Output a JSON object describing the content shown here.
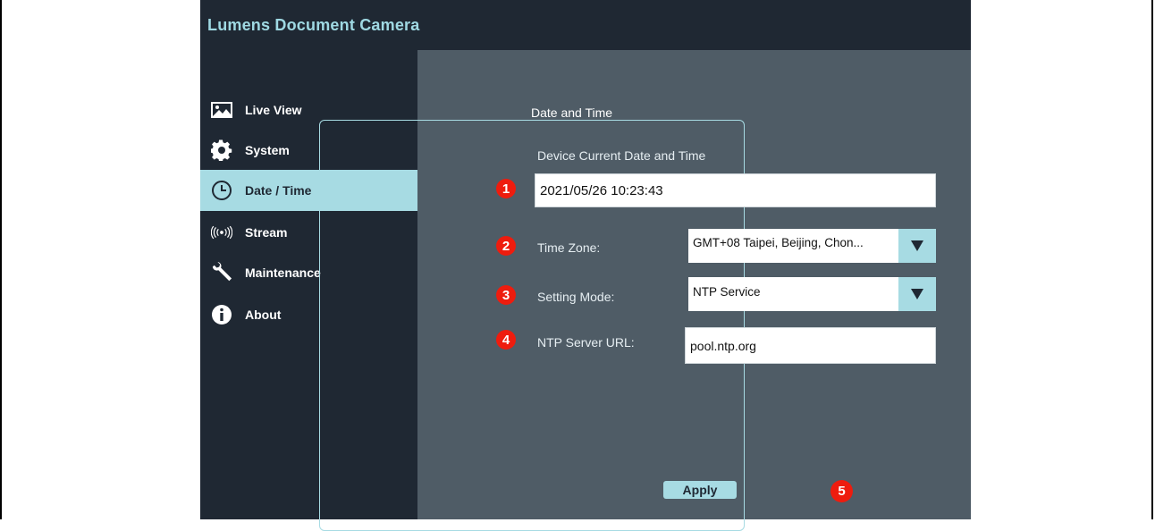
{
  "app": {
    "title": "Lumens Document Camera"
  },
  "sidebar": {
    "items": [
      {
        "label": "Live View",
        "icon": "image-icon"
      },
      {
        "label": "System",
        "icon": "gear-icon"
      },
      {
        "label": "Date / Time",
        "icon": "clock-icon",
        "active": true
      },
      {
        "label": "Stream",
        "icon": "broadcast-icon"
      },
      {
        "label": "Maintenance",
        "icon": "wrench-icon"
      },
      {
        "label": "About",
        "icon": "info-icon"
      }
    ]
  },
  "datetime": {
    "section_title": "Date and Time",
    "current_label": "Device Current Date and Time",
    "current_value": "2021/05/26 10:23:43",
    "timezone_label": "Time Zone:",
    "timezone_value": "GMT+08 Taipei, Beijing, Chon...",
    "mode_label": "Setting Mode:",
    "mode_value": "NTP Service",
    "ntp_label": "NTP Server URL:",
    "ntp_value": "pool.ntp.org",
    "apply_label": "Apply"
  },
  "badges": [
    "1",
    "2",
    "3",
    "4",
    "5"
  ],
  "colors": {
    "sidebar_bg": "#1f2833",
    "accent": "#a7dbe3",
    "content_bg": "#4f5c66",
    "badge": "#ee1c0e"
  }
}
